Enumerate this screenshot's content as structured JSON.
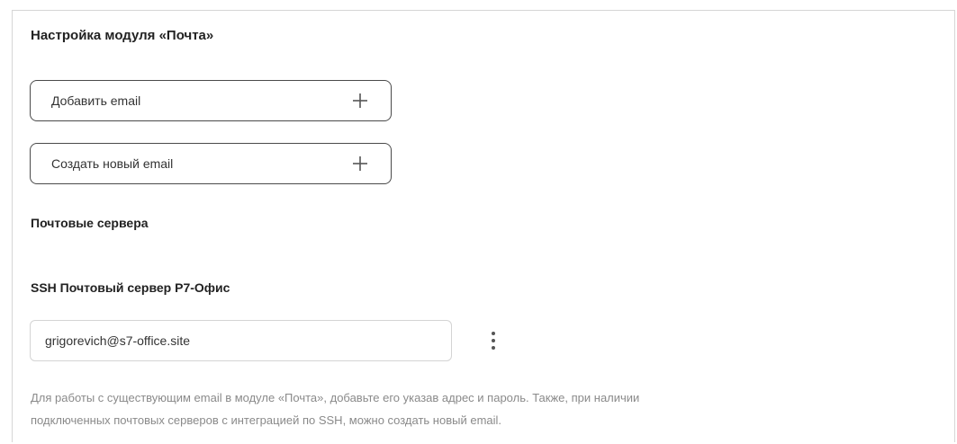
{
  "module_settings": {
    "title": "Настройка модуля «Почта»"
  },
  "actions": {
    "add_email_label": "Добавить email",
    "create_email_label": "Создать новый email",
    "icon": "plus-icon"
  },
  "mail_servers": {
    "heading": "Почтовые сервера",
    "server_name": "SSH Почтовый сервер Р7-Офис",
    "email_value": "grigorevich@s7-office.site",
    "menu_icon": "kebab-menu-icon"
  },
  "help_text": {
    "line1": "Для работы с существующим email в модуле «Почта», добавьте его указав адрес и пароль. Также, при наличии",
    "line2": "подключенных почтовых серверов с интеграцией по SSH, можно создать новый email."
  }
}
